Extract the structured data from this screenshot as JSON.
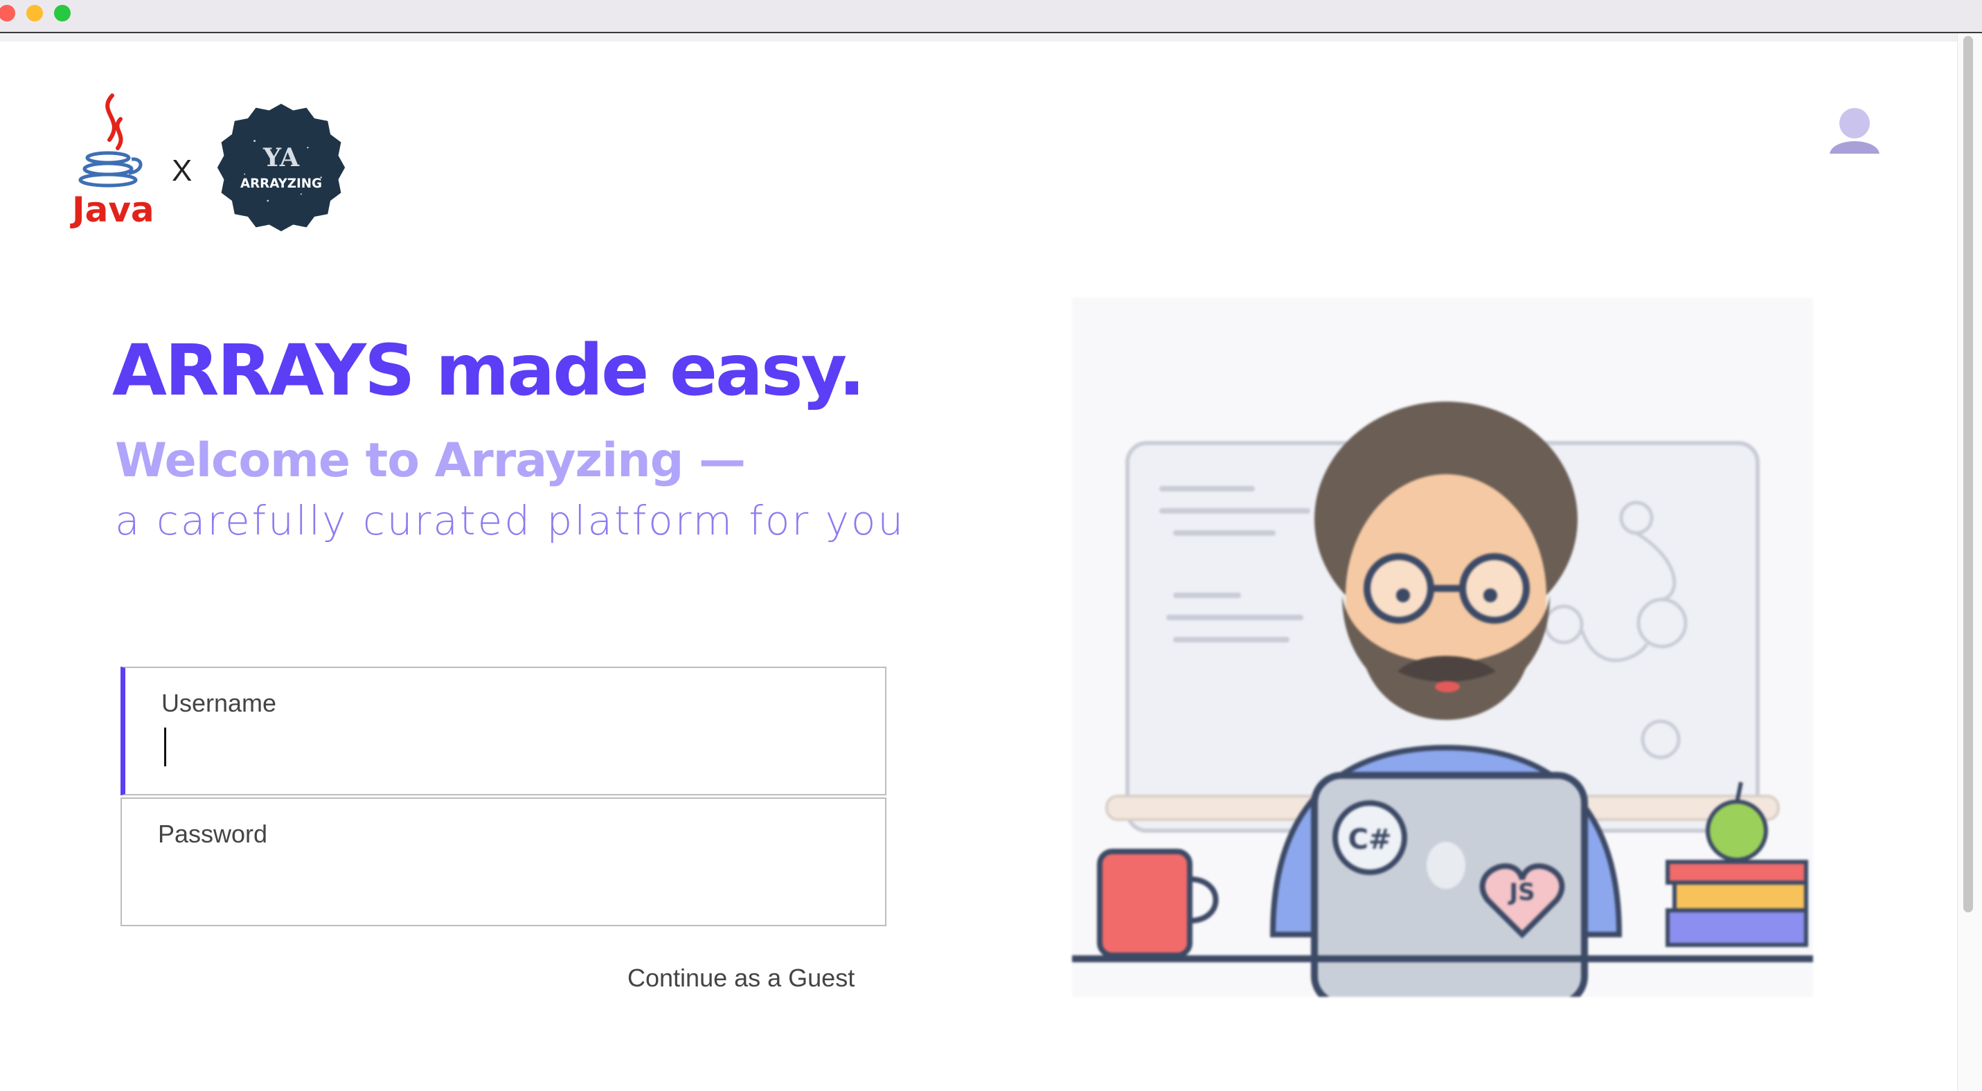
{
  "window": {
    "controls": [
      "close",
      "minimize",
      "maximize"
    ]
  },
  "header": {
    "logo_left_text": "Java",
    "logo_separator": "X",
    "logo_right_text": "ARRAYZING",
    "logo_right_monogram": "YA",
    "account_icon": "user-avatar-icon"
  },
  "hero": {
    "headline": "ARRAYS made easy.",
    "welcome": "Welcome to Arrayzing —",
    "tagline": "a carefully curated platform for you"
  },
  "login": {
    "username_label": "Username",
    "username_value": "",
    "password_label": "Password",
    "password_value": "",
    "guest_link": "Continue as a Guest"
  },
  "illustration": {
    "laptop_sticker_1": "C#",
    "laptop_sticker_2": "JS"
  },
  "colors": {
    "accent": "#5b3ef5",
    "welcome": "#b0a5fa",
    "tagline": "#8b7cf0",
    "badge_bg": "#1f3447",
    "avatar": "#a9a0d8"
  }
}
